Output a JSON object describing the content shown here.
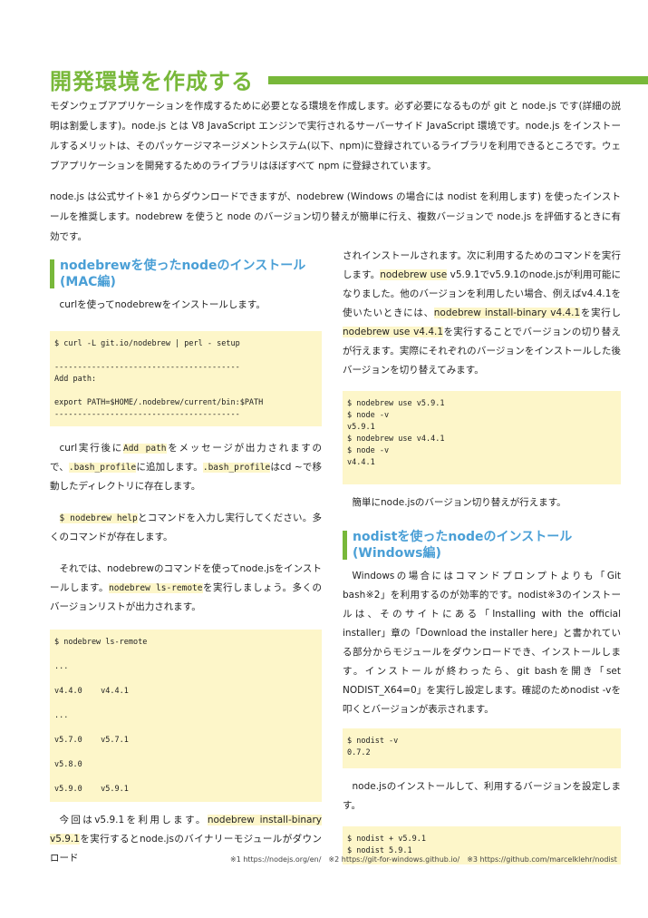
{
  "title": "開発環境を作成する",
  "intro": {
    "p1": "モダンウェブアプリケーションを作成するために必要となる環境を作成します。必ず必要になるものが git と node.js です(詳細の説明は割愛します)。node.js とは V8 JavaScript エンジンで実行されるサーバーサイド JavaScript 環境です。node.js をインストールするメリットは、そのパッケージマネージメントシステム(以下、npm)に登録されているライブラリを利用できるところです。ウェブアプリケーションを開発するためのライブラリはほぼすべて npm に登録されています。",
    "p2": "node.js は公式サイト※1 からダウンロードできますが、nodebrew (Windows の場合には nodist を利用します) を使ったインストールを推奨します。nodebrew を使うと node のバージョン切り替えが簡単に行え、複数バージョンで node.js を評価するときに有効です。"
  },
  "left": {
    "heading1": "nodebrewを使ったnodeのインストール",
    "heading2": "(MAC編)",
    "p_curl": "curlを使ってnodebrewをインストールします。",
    "code1": "$ curl -L git.io/nodebrew | perl - setup\n\n----------------------------------------\nAdd path:\n\nexport PATH=$HOME/.nodebrew/current/bin:$PATH\n----------------------------------------",
    "p2_a": "curl実行後に",
    "p2_code1": "Add path",
    "p2_b": "をメッセージが出力されますので、",
    "p2_code2": ".bash_profile",
    "p2_c": "に追加します。",
    "p2_code3": ".bash_profile",
    "p2_d": "はcd ~で移動したディレクトリに存在します。",
    "p3_code": "$ nodebrew help",
    "p3_b": "とコマンドを入力し実行してください。多くのコマンドが存在します。",
    "p4_a": "それでは、nodebrewのコマンドを使ってnode.jsをインストールします。",
    "p4_code": "nodebrew ls-remote",
    "p4_b": "を実行しましょう。多くのバージョンリストが出力されます。",
    "code2": "$ nodebrew ls-remote\n\n...\n\nv4.4.0    v4.4.1\n\n...\n\nv5.7.0    v5.7.1\n\nv5.8.0\n\nv5.9.0    v5.9.1",
    "p5_a": "今回はv5.9.1を利用します。",
    "p5_hl": "nodebrew install-binary v5.9.1",
    "p5_b": "を実行するとnode.jsのバイナリーモジュールがダウンロード"
  },
  "right": {
    "p1_a": "されインストールされます。次に利用するためのコマンドを実行します。",
    "p1_hl": "nodebrew use",
    "p1_b": " v5.9.1でv5.9.1のnode.jsが利用可能になりました。他のバージョンを利用したい場合、例えばv4.4.1を使いたいときには、",
    "p1_hl2": "nodebrew install-binary v4.4.1",
    "p1_c": "を実行し",
    "p1_hl3": "nodebrew use v4.4.1",
    "p1_d": "を実行することでバージョンの切り替えが行えます。実際にそれぞれのバージョンをインストールした後バージョンを切り替えてみます。",
    "code3": "$ nodebrew use v5.9.1\n$ node -v\nv5.9.1\n$ nodebrew use v4.4.1\n$ node -v\nv4.4.1",
    "p2": "簡単にnode.jsのバージョン切り替えが行えます。",
    "heading1": "nodistを使ったnodeのインストール",
    "heading2": "(Windows編)",
    "p3": "Windowsの場合にはコマンドプロンプトよりも「Git bash※2」を利用するのが効率的です。nodist※3のインストールは、そのサイトにある「Installing with the official installer」章の「Download the installer here」と書かれている部分からモジュールをダウンロードでき、インストールします。インストールが終わったら、git bashを開き「set NODIST_X64=0」を実行し設定します。確認のためnodist -vを叩くとバージョンが表示されます。",
    "code4": "$ nodist -v\n0.7.2",
    "p4": "node.jsのインストールして、利用するバージョンを設定します。",
    "code5": "$ nodist + v5.9.1\n$ nodist 5.9.1"
  },
  "footnotes": "※1 https://nodejs.org/en/　※2 https://git-for-windows.github.io/　※3 https://github.com/marcelklehr/nodist",
  "colors": {
    "accent_green": "#78b83a",
    "heading_blue": "#4a9fd6",
    "code_bg": "#fdf6c9",
    "skyline": "#cfe1ef"
  }
}
